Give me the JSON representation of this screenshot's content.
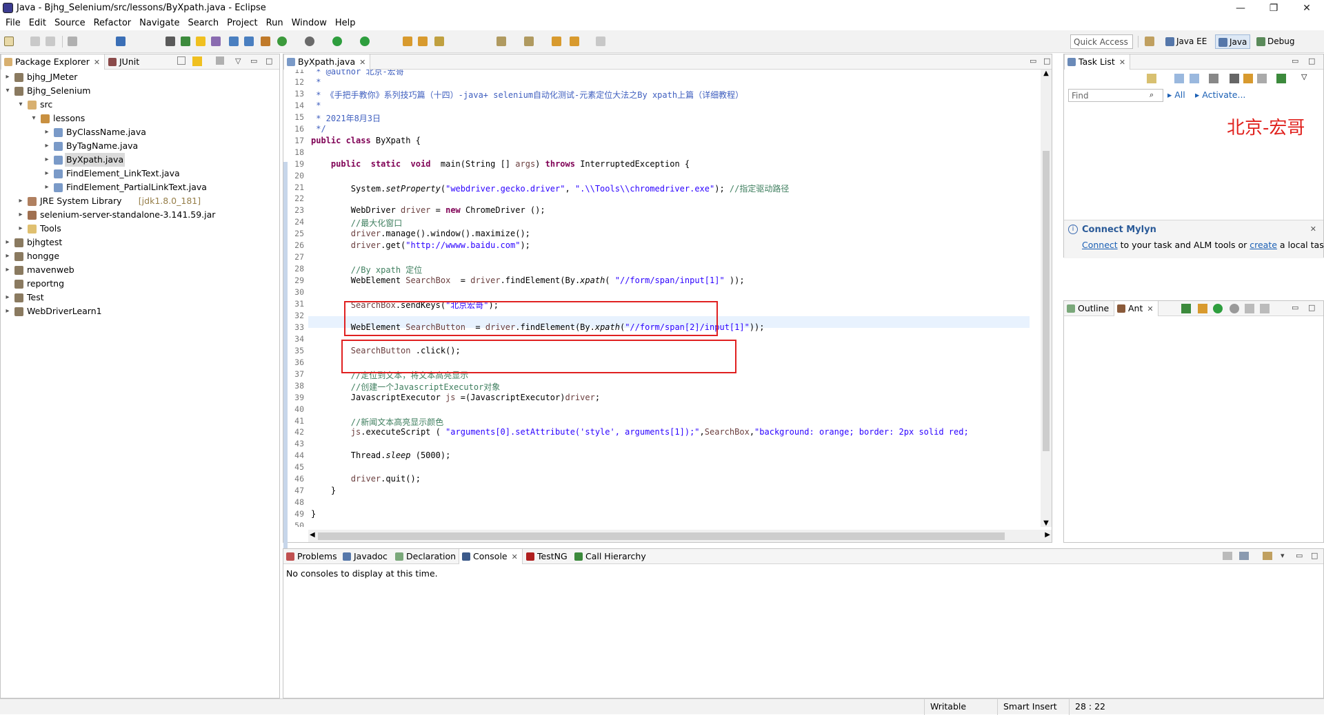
{
  "window": {
    "title": "Java - Bjhg_Selenium/src/lessons/ByXpath.java - Eclipse",
    "controls": [
      "—",
      "❐",
      "✕"
    ]
  },
  "menu": [
    "File",
    "Edit",
    "Source",
    "Refactor",
    "Navigate",
    "Search",
    "Project",
    "Run",
    "Window",
    "Help"
  ],
  "toolbar": {
    "quick_access_placeholder": "Quick Access",
    "perspectives": [
      "Java EE",
      "Java",
      "Debug"
    ],
    "active_perspective": "Java"
  },
  "package_explorer": {
    "tabs": [
      "Package Explorer",
      "JUnit"
    ],
    "tree": [
      {
        "label": "bjhg_JMeter",
        "depth": 0,
        "state": "collapsed",
        "icon": "project-icon"
      },
      {
        "label": "Bjhg_Selenium",
        "depth": 0,
        "state": "expanded",
        "icon": "project-icon"
      },
      {
        "label": "src",
        "depth": 1,
        "state": "expanded",
        "icon": "source-folder-icon"
      },
      {
        "label": "lessons",
        "depth": 2,
        "state": "expanded",
        "icon": "package-icon"
      },
      {
        "label": "ByClassName.java",
        "depth": 3,
        "state": "collapsed",
        "icon": "java-file-icon"
      },
      {
        "label": "ByTagName.java",
        "depth": 3,
        "state": "collapsed",
        "icon": "java-file-icon"
      },
      {
        "label": "ByXpath.java",
        "depth": 3,
        "state": "collapsed",
        "icon": "java-file-icon",
        "selected": true
      },
      {
        "label": "FindElement_LinkText.java",
        "depth": 3,
        "state": "collapsed",
        "icon": "java-file-icon"
      },
      {
        "label": "FindElement_PartialLinkText.java",
        "depth": 3,
        "state": "collapsed",
        "icon": "java-file-icon"
      },
      {
        "label": "JRE System Library",
        "decoration": "[jdk1.8.0_181]",
        "depth": 1,
        "state": "collapsed",
        "icon": "library-icon"
      },
      {
        "label": "selenium-server-standalone-3.141.59.jar",
        "depth": 1,
        "state": "collapsed",
        "icon": "jar-icon"
      },
      {
        "label": "Tools",
        "depth": 1,
        "state": "collapsed",
        "icon": "folder-icon"
      },
      {
        "label": "bjhgtest",
        "depth": 0,
        "state": "collapsed",
        "icon": "project-icon"
      },
      {
        "label": "hongge",
        "depth": 0,
        "state": "collapsed",
        "icon": "project-icon"
      },
      {
        "label": "mavenweb",
        "depth": 0,
        "state": "collapsed",
        "icon": "project-icon"
      },
      {
        "label": "reportng",
        "depth": 0,
        "state": "none",
        "icon": "project-icon"
      },
      {
        "label": "Test",
        "depth": 0,
        "state": "collapsed",
        "icon": "project-icon"
      },
      {
        "label": "WebDriverLearn1",
        "depth": 0,
        "state": "collapsed",
        "icon": "project-icon"
      }
    ]
  },
  "editor": {
    "tab": "ByXpath.java",
    "lines": [
      {
        "n": "11",
        "html": "<span class=\"jdoc\"> * @author 北京-宏哥</span>"
      },
      {
        "n": "12",
        "html": "<span class=\"jdoc\"> *</span>"
      },
      {
        "n": "13",
        "html": "<span class=\"jdoc\"> * 《手把手教你》系列技巧篇（十四）-java+ selenium自动化测试-元素定位大法之By xpath上篇（详细教程）</span>"
      },
      {
        "n": "14",
        "html": "<span class=\"jdoc\"> *</span>"
      },
      {
        "n": "15",
        "html": "<span class=\"jdoc\"> * 2021年8月3日</span>"
      },
      {
        "n": "16",
        "html": "<span class=\"jdoc\"> */</span>"
      },
      {
        "n": "17",
        "html": "<span class=\"kw\">public class</span> ByXpath {"
      },
      {
        "n": "18",
        "html": ""
      },
      {
        "n": "19",
        "html": "    <span class=\"kw\">public</span>  <span class=\"kw\">static</span>  <span class=\"kw\">void</span>  main(String [] <span class=\"var\">args</span>) <span class=\"kw\">throws</span> InterruptedException {"
      },
      {
        "n": "20",
        "html": ""
      },
      {
        "n": "21",
        "html": "        System.<i>setProperty</i>(<span class=\"str\">\"webdriver.gecko.driver\"</span>, <span class=\"str\">\".\\\\Tools\\\\chromedriver.exe\"</span>); <span class=\"cmt\">//指定驱动路径</span>"
      },
      {
        "n": "22",
        "html": ""
      },
      {
        "n": "23",
        "html": "        WebDriver <span class=\"var\">driver</span> = <span class=\"kw\">new</span> ChromeDriver ();"
      },
      {
        "n": "24",
        "html": "        <span class=\"cmt\">//最大化窗口</span>"
      },
      {
        "n": "25",
        "html": "        <span class=\"var\">driver</span>.manage().window().maximize();"
      },
      {
        "n": "26",
        "html": "        <span class=\"var\">driver</span>.get(<span class=\"str\">\"http://wwww.baidu.com\"</span>);"
      },
      {
        "n": "27",
        "html": ""
      },
      {
        "n": "28",
        "html": "        <span class=\"cmt\">//By xpath 定位</span>"
      },
      {
        "n": "29",
        "html": "        WebElement <span class=\"var\">SearchBox</span>  = <span class=\"var\">driver</span>.findElement(By.<i>xpath</i>( <span class=\"str\">\"//form/span/input[1]\"</span> ));"
      },
      {
        "n": "30",
        "html": ""
      },
      {
        "n": "31",
        "html": "        <span class=\"var\">SearchBox</span>.sendKeys(<span class=\"str\">\"北京宏哥\"</span>);"
      },
      {
        "n": "32",
        "html": ""
      },
      {
        "n": "33",
        "html": "        WebElement <span class=\"var\">SearchButton</span>  = <span class=\"var\">driver</span>.findElement(By.<i>xpath</i>(<span class=\"str\">\"//form/span[2]/input[1]\"</span>));"
      },
      {
        "n": "34",
        "html": ""
      },
      {
        "n": "35",
        "html": "        <span class=\"var\">SearchButton</span> .click();"
      },
      {
        "n": "36",
        "html": ""
      },
      {
        "n": "37",
        "html": "        <span class=\"cmt\">//定位到文本，将文本高亮显示</span>"
      },
      {
        "n": "38",
        "html": "        <span class=\"cmt\">//创建一个JavascriptExecutor对象</span>"
      },
      {
        "n": "39",
        "html": "        JavascriptExecutor <span class=\"var\">js</span> =(JavascriptExecutor)<span class=\"var\">driver</span>;"
      },
      {
        "n": "40",
        "html": ""
      },
      {
        "n": "41",
        "html": "        <span class=\"cmt\">//新闻文本高亮显示颜色</span>"
      },
      {
        "n": "42",
        "html": "        <span class=\"var\">js</span>.executeScript ( <span class=\"str\">\"arguments[0].setAttribute('style', arguments[1]);\"</span>,<span class=\"var\">SearchBox</span>,<span class=\"str\">\"background: orange; border: 2px solid red;</span>"
      },
      {
        "n": "43",
        "html": ""
      },
      {
        "n": "44",
        "html": "        Thread.<i>sleep</i> (5000);"
      },
      {
        "n": "45",
        "html": ""
      },
      {
        "n": "46",
        "html": "        <span class=\"var\">driver</span>.quit();"
      },
      {
        "n": "47",
        "html": "    }"
      },
      {
        "n": "48",
        "html": ""
      },
      {
        "n": "49",
        "html": "}"
      },
      {
        "n": "50",
        "html": ""
      }
    ]
  },
  "task_list": {
    "tab": "Task List",
    "find_placeholder": "Find",
    "filter_all": "All",
    "activate": "Activate...",
    "watermark": "北京-宏哥",
    "mylyn_title": "Connect Mylyn",
    "mylyn_link1": "Connect",
    "mylyn_text1": " to your task and ALM tools or ",
    "mylyn_link2": "create",
    "mylyn_text2": " a local task."
  },
  "outline": {
    "tabs": [
      "Outline",
      "Ant"
    ]
  },
  "bottom": {
    "tabs": [
      "Problems",
      "Javadoc",
      "Declaration",
      "Console",
      "TestNG",
      "Call Hierarchy"
    ],
    "active": "Console",
    "console_message": "No consoles to display at this time."
  },
  "status": {
    "writable": "Writable",
    "insert_mode": "Smart Insert",
    "position": "28 : 22"
  },
  "colors": {
    "keyword": "#7f0055",
    "string": "#2a00ff",
    "comment": "#3f7f5f",
    "javadoc": "#3f5fbf",
    "annotation_box": "#e02020",
    "watermark": "#e0211d"
  }
}
